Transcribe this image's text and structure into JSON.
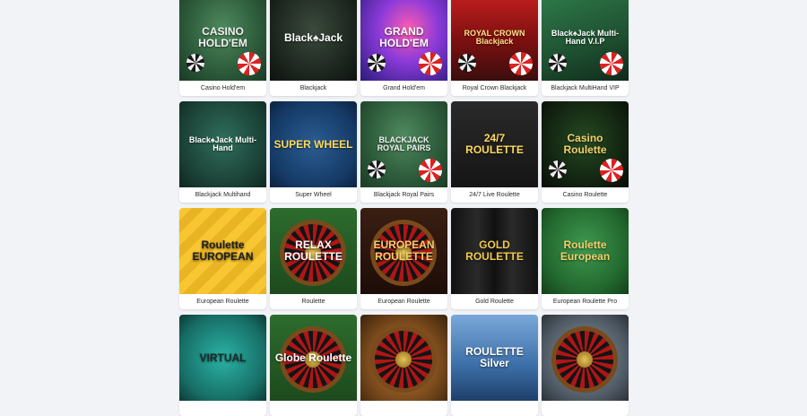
{
  "games": [
    {
      "title": "Casino Hold'em",
      "art": "CASINO HOLD'EM",
      "style": "felt-green"
    },
    {
      "title": "Blackjack",
      "art": "Black♠Jack",
      "style": "felt-dark"
    },
    {
      "title": "Grand Hold'em",
      "art": "GRAND HOLD'EM",
      "style": "neon"
    },
    {
      "title": "Royal Crown Blackjack",
      "art": "ROYAL CROWN Blackjack",
      "style": "royal"
    },
    {
      "title": "Blackjack MultiHand VIP",
      "art": "Black♠Jack Multi-Hand V.I.P",
      "style": "vip"
    },
    {
      "title": "Blackjack Multihand",
      "art": "Black♠Jack Multi-Hand",
      "style": "felt-teal"
    },
    {
      "title": "Super Wheel",
      "art": "SUPER WHEEL",
      "style": "wheel-bg"
    },
    {
      "title": "Blackjack Royal Pairs",
      "art": "BLACKJACK ROYAL PAIRS",
      "style": "felt-green"
    },
    {
      "title": "24/7 Live Roulette",
      "art": "24/7 ROULETTE",
      "style": "live"
    },
    {
      "title": "Casino Roulette",
      "art": "Casino Roulette",
      "style": "gold-dark"
    },
    {
      "title": "European Roulette",
      "art": "Roulette EUROPEAN",
      "style": "yellow"
    },
    {
      "title": "Roulette",
      "art": "RELAX ROULETTE",
      "style": "relax"
    },
    {
      "title": "European Roulette",
      "art": "EUROPEAN ROULETTE",
      "style": "euro-red"
    },
    {
      "title": "Gold Roulette",
      "art": "GOLD ROULETTE",
      "style": "curtain"
    },
    {
      "title": "European Roulette Pro",
      "art": "Roulette European",
      "style": "felt-bright"
    },
    {
      "title": "",
      "art": "VIRTUAL",
      "style": "teal2"
    },
    {
      "title": "",
      "art": "Globe Roulette",
      "style": "relax"
    },
    {
      "title": "",
      "art": "",
      "style": "wood"
    },
    {
      "title": "",
      "art": "ROULETTE Silver",
      "style": "silver"
    },
    {
      "title": "",
      "art": "",
      "style": "grey"
    }
  ]
}
